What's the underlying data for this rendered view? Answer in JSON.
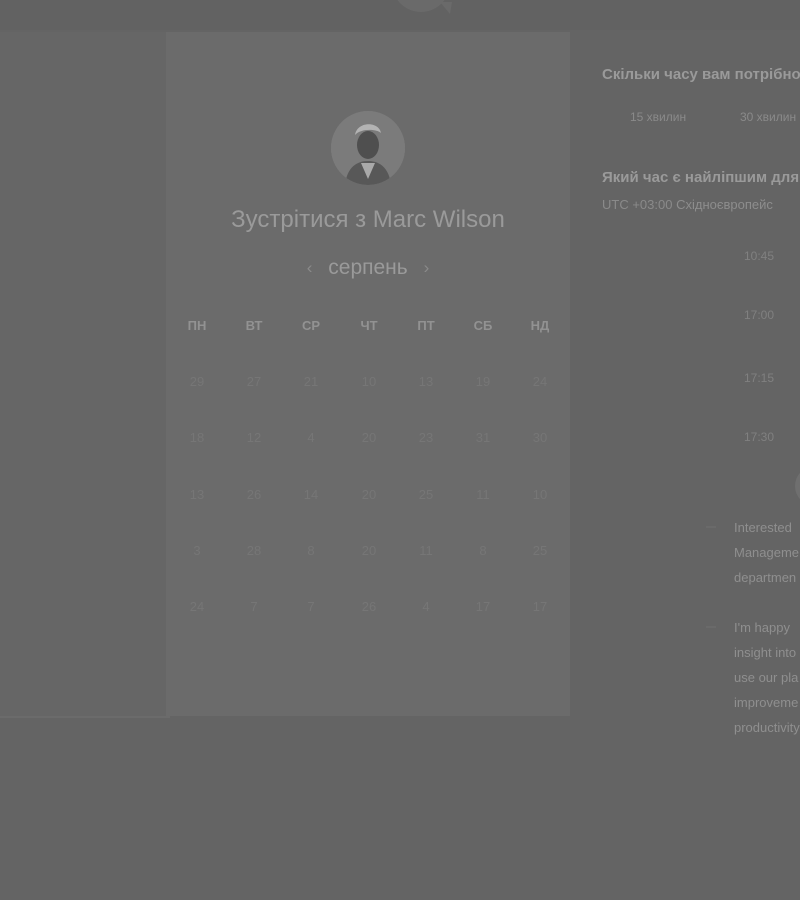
{
  "booking": {
    "title": "Зустрітися з Marc Wilson",
    "month": "серпень",
    "prev_icon": "‹",
    "next_icon": "›",
    "weekdays": [
      "ПН",
      "ВТ",
      "СР",
      "ЧТ",
      "ПТ",
      "СБ",
      "НД"
    ],
    "weeks": [
      [
        "29",
        "27",
        "21",
        "10",
        "13",
        "19",
        "24"
      ],
      [
        "18",
        "12",
        "4",
        "20",
        "23",
        "31",
        "30"
      ],
      [
        "13",
        "26",
        "14",
        "20",
        "25",
        "11",
        "10"
      ],
      [
        "3",
        "28",
        "8",
        "20",
        "11",
        "8",
        "25"
      ],
      [
        "24",
        "7",
        "7",
        "26",
        "4",
        "17",
        "17"
      ]
    ]
  },
  "duration": {
    "question": "Скільки часу вам потрібно",
    "options": [
      "15 хвилин",
      "30 хвилин"
    ]
  },
  "time": {
    "question": "Який час є найліпшим для",
    "timezone_offset": "UTC +03:00",
    "timezone_name": "Східноєвропейс",
    "slots": [
      "10:45",
      "17:00",
      "17:15",
      "17:30"
    ]
  },
  "message": {
    "paragraph1": [
      "Interested",
      "Manageme",
      "departmen"
    ],
    "paragraph2": [
      "I'm happy",
      "insight into",
      "use our pla",
      "improveme",
      "productivity"
    ]
  }
}
